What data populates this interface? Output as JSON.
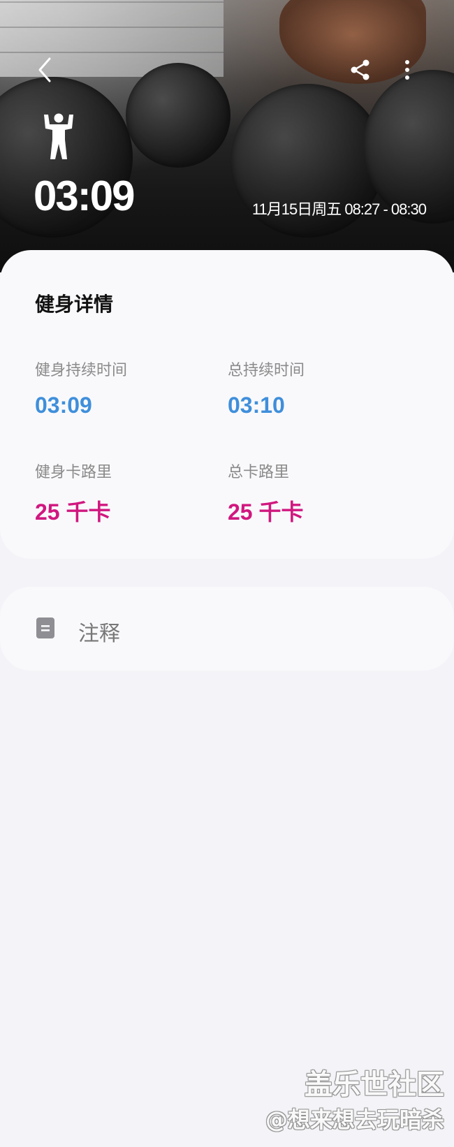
{
  "header": {
    "duration": "03:09",
    "date_range": "11月15日周五 08:27 - 08:30",
    "activity_icon": "weightlifting-person-icon",
    "back_icon": "back-chevron-icon",
    "share_icon": "share-icon",
    "more_icon": "more-vertical-icon"
  },
  "details": {
    "title": "健身详情",
    "metrics": [
      {
        "label": "健身持续时间",
        "value": "03:09"
      },
      {
        "label": "总持续时间",
        "value": "03:10"
      },
      {
        "label": "健身卡路里",
        "value": "25 千卡"
      },
      {
        "label": "总卡路里",
        "value": "25 千卡"
      }
    ]
  },
  "notes": {
    "label": "注释",
    "icon": "note-icon"
  },
  "watermark": {
    "line1": "盖乐世社区",
    "line2": "@想来想去玩暗杀"
  },
  "colors": {
    "duration_blue": "#3f8fdb",
    "calorie_pink": "#d1177f"
  }
}
